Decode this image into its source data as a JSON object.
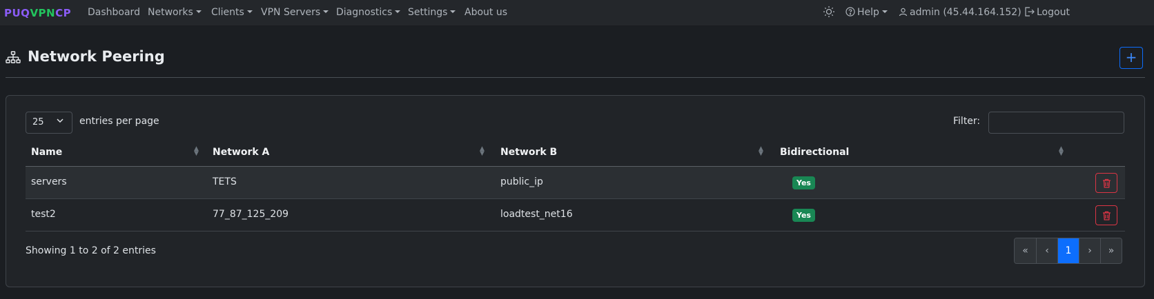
{
  "navbar": {
    "brand": {
      "part1": "PUQ",
      "part2": "VPN",
      "part3": "CP"
    },
    "items": [
      {
        "label": "Dashboard",
        "dropdown": false
      },
      {
        "label": "Networks",
        "dropdown": true
      },
      {
        "label": "Clients",
        "dropdown": true
      },
      {
        "label": "VPN Servers",
        "dropdown": true
      },
      {
        "label": "Diagnostics",
        "dropdown": true
      },
      {
        "label": "Settings",
        "dropdown": true
      },
      {
        "label": "About us",
        "dropdown": false
      }
    ],
    "theme_icon": "sun-icon",
    "help_label": "Help",
    "user_label": "admin (45.44.164.152)",
    "logout_label": "Logout"
  },
  "page": {
    "title": "Network Peering",
    "title_icon": "network-icon",
    "add_button": "+"
  },
  "table_controls": {
    "page_length": "25",
    "page_length_label": "entries per page",
    "filter_label": "Filter:",
    "filter_value": ""
  },
  "table": {
    "columns": [
      "Name",
      "Network A",
      "Network B",
      "Bidirectional"
    ],
    "rows": [
      {
        "name": "servers",
        "network_a": "TETS",
        "network_b": "public_ip",
        "bidirectional": "Yes"
      },
      {
        "name": "test2",
        "network_a": "77_87_125_209",
        "network_b": "loadtest_net16",
        "bidirectional": "Yes"
      }
    ]
  },
  "footer": {
    "info": "Showing 1 to 2 of 2 entries",
    "pager": [
      "«",
      "‹",
      "1",
      "›",
      "»"
    ],
    "active_page": "1"
  },
  "colors": {
    "background": "#1b1e22",
    "navbar": "#24272b",
    "brand_purple": "#8b5cf6",
    "brand_green": "#22c55e",
    "primary": "#0d6efd",
    "success_badge": "#198754",
    "danger": "#dc3545"
  }
}
